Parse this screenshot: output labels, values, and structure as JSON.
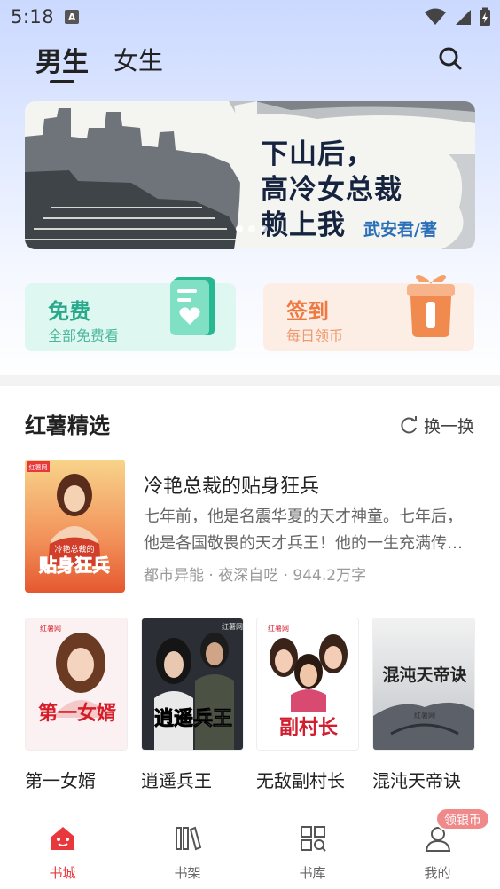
{
  "status_bar": {
    "time": "5:18",
    "notification_letter": "A"
  },
  "tabs": [
    {
      "label": "男生",
      "active": true
    },
    {
      "label": "女生",
      "active": false
    }
  ],
  "banner": {
    "lines": [
      "下山后，",
      "高冷女总裁",
      "赖上我"
    ],
    "author": "武安君/著",
    "slide_count": 3,
    "active_slide": 1
  },
  "cards": {
    "free": {
      "title": "免费",
      "subtitle": "全部免费看"
    },
    "sign": {
      "title": "签到",
      "subtitle": "每日领币"
    }
  },
  "section": {
    "title": "红薯精选",
    "refresh_label": "换一换"
  },
  "featured": {
    "title": "冷艳总裁的贴身狂兵",
    "description": "七年前，他是名震华夏的天才神童。七年后，他是各国敬畏的天才兵王！他的一生充满传奇…",
    "meta": "都市异能 · 夜深自呓 · 944.2万字",
    "cover_text": "贴身狂兵",
    "cover_small": "冷艳总裁的",
    "cover_brand": "红薯网"
  },
  "books": [
    {
      "title": "第一女婿",
      "cover_text": "第一女婿",
      "cover_brand": "红薯网"
    },
    {
      "title": "逍遥兵王",
      "cover_text": "逍遥兵王",
      "cover_brand": "红薯网"
    },
    {
      "title": "无敌副村长",
      "cover_text": "副村长",
      "cover_brand": "红薯网"
    },
    {
      "title": "混沌天帝诀",
      "cover_text": "混沌天帝诀",
      "cover_brand": "红薯网"
    }
  ],
  "bottom_nav": [
    {
      "label": "书城",
      "icon": "home-icon",
      "active": true
    },
    {
      "label": "书架",
      "icon": "bookshelf-icon",
      "active": false
    },
    {
      "label": "书库",
      "icon": "library-grid-icon",
      "active": false
    },
    {
      "label": "我的",
      "icon": "profile-icon",
      "active": false
    }
  ],
  "badge": "领银币",
  "colors": {
    "accent_red": "#e8383c",
    "free_green": "#28a98c",
    "sign_orange": "#ee7a43",
    "banner_title": "#16243f",
    "banner_author": "#2a6fb8"
  }
}
